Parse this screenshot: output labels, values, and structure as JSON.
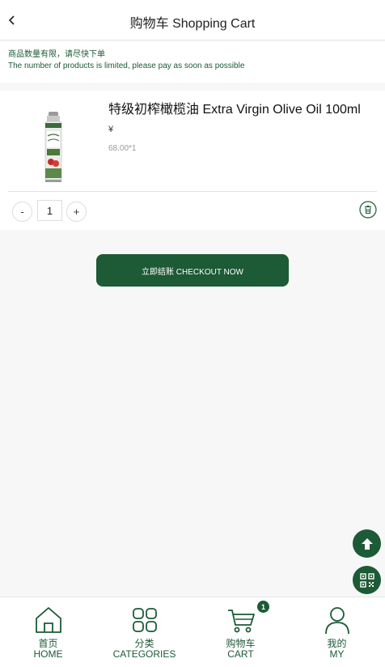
{
  "header": {
    "title": "购物车 Shopping Cart"
  },
  "notice": {
    "cn": "商品数量有限，请尽快下单",
    "en": "The number of products is limited, please pay as soon as possible"
  },
  "cart": {
    "items": [
      {
        "name": "特级初榨橄榄油 Extra Virgin Olive Oil 100ml",
        "currency": "¥",
        "price_qty": "68.00*1",
        "quantity": "1"
      }
    ],
    "minus_label": "-",
    "plus_label": "+"
  },
  "checkout": {
    "label": "立即结账 CHECKOUT NOW"
  },
  "tabbar": {
    "tabs": [
      {
        "cn": "首页",
        "en": "HOME",
        "icon": "home-icon"
      },
      {
        "cn": "分类",
        "en": "CATEGORIES",
        "icon": "categories-icon"
      },
      {
        "cn": "购物车",
        "en": "CART",
        "icon": "cart-icon",
        "badge": "1"
      },
      {
        "cn": "我的",
        "en": "MY",
        "icon": "user-icon"
      }
    ]
  },
  "colors": {
    "brand": "#1d5a36",
    "background": "#f7f7f7"
  }
}
